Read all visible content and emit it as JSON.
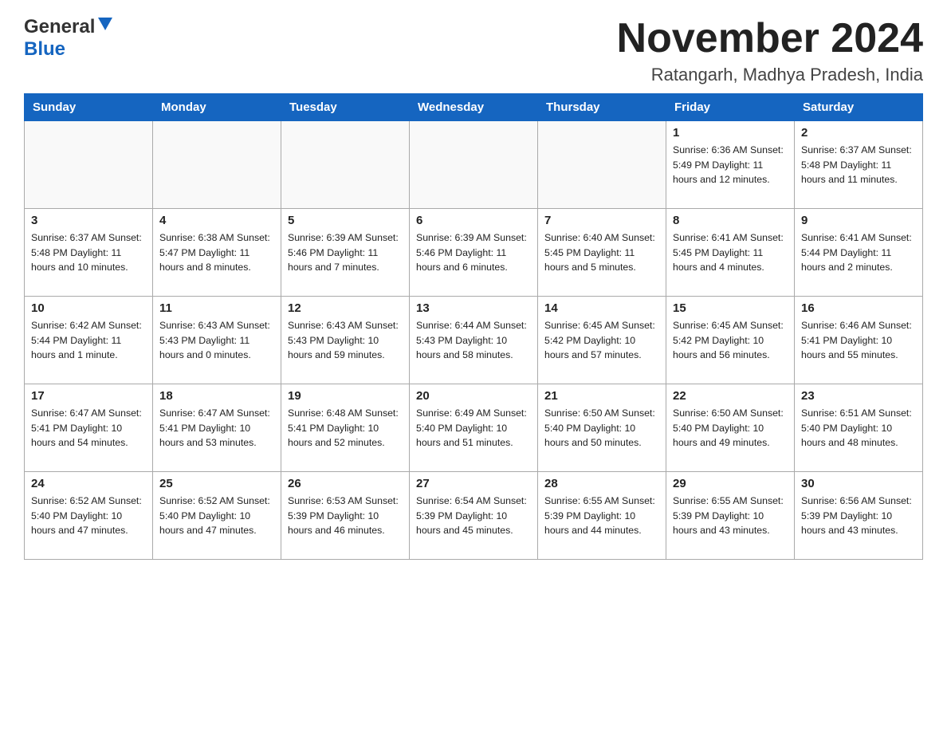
{
  "header": {
    "logo_general": "General",
    "logo_blue": "Blue",
    "main_title": "November 2024",
    "subtitle": "Ratangarh, Madhya Pradesh, India"
  },
  "days_of_week": [
    "Sunday",
    "Monday",
    "Tuesday",
    "Wednesday",
    "Thursday",
    "Friday",
    "Saturday"
  ],
  "weeks": [
    [
      {
        "day": "",
        "info": ""
      },
      {
        "day": "",
        "info": ""
      },
      {
        "day": "",
        "info": ""
      },
      {
        "day": "",
        "info": ""
      },
      {
        "day": "",
        "info": ""
      },
      {
        "day": "1",
        "info": "Sunrise: 6:36 AM\nSunset: 5:49 PM\nDaylight: 11 hours and 12 minutes."
      },
      {
        "day": "2",
        "info": "Sunrise: 6:37 AM\nSunset: 5:48 PM\nDaylight: 11 hours and 11 minutes."
      }
    ],
    [
      {
        "day": "3",
        "info": "Sunrise: 6:37 AM\nSunset: 5:48 PM\nDaylight: 11 hours and 10 minutes."
      },
      {
        "day": "4",
        "info": "Sunrise: 6:38 AM\nSunset: 5:47 PM\nDaylight: 11 hours and 8 minutes."
      },
      {
        "day": "5",
        "info": "Sunrise: 6:39 AM\nSunset: 5:46 PM\nDaylight: 11 hours and 7 minutes."
      },
      {
        "day": "6",
        "info": "Sunrise: 6:39 AM\nSunset: 5:46 PM\nDaylight: 11 hours and 6 minutes."
      },
      {
        "day": "7",
        "info": "Sunrise: 6:40 AM\nSunset: 5:45 PM\nDaylight: 11 hours and 5 minutes."
      },
      {
        "day": "8",
        "info": "Sunrise: 6:41 AM\nSunset: 5:45 PM\nDaylight: 11 hours and 4 minutes."
      },
      {
        "day": "9",
        "info": "Sunrise: 6:41 AM\nSunset: 5:44 PM\nDaylight: 11 hours and 2 minutes."
      }
    ],
    [
      {
        "day": "10",
        "info": "Sunrise: 6:42 AM\nSunset: 5:44 PM\nDaylight: 11 hours and 1 minute."
      },
      {
        "day": "11",
        "info": "Sunrise: 6:43 AM\nSunset: 5:43 PM\nDaylight: 11 hours and 0 minutes."
      },
      {
        "day": "12",
        "info": "Sunrise: 6:43 AM\nSunset: 5:43 PM\nDaylight: 10 hours and 59 minutes."
      },
      {
        "day": "13",
        "info": "Sunrise: 6:44 AM\nSunset: 5:43 PM\nDaylight: 10 hours and 58 minutes."
      },
      {
        "day": "14",
        "info": "Sunrise: 6:45 AM\nSunset: 5:42 PM\nDaylight: 10 hours and 57 minutes."
      },
      {
        "day": "15",
        "info": "Sunrise: 6:45 AM\nSunset: 5:42 PM\nDaylight: 10 hours and 56 minutes."
      },
      {
        "day": "16",
        "info": "Sunrise: 6:46 AM\nSunset: 5:41 PM\nDaylight: 10 hours and 55 minutes."
      }
    ],
    [
      {
        "day": "17",
        "info": "Sunrise: 6:47 AM\nSunset: 5:41 PM\nDaylight: 10 hours and 54 minutes."
      },
      {
        "day": "18",
        "info": "Sunrise: 6:47 AM\nSunset: 5:41 PM\nDaylight: 10 hours and 53 minutes."
      },
      {
        "day": "19",
        "info": "Sunrise: 6:48 AM\nSunset: 5:41 PM\nDaylight: 10 hours and 52 minutes."
      },
      {
        "day": "20",
        "info": "Sunrise: 6:49 AM\nSunset: 5:40 PM\nDaylight: 10 hours and 51 minutes."
      },
      {
        "day": "21",
        "info": "Sunrise: 6:50 AM\nSunset: 5:40 PM\nDaylight: 10 hours and 50 minutes."
      },
      {
        "day": "22",
        "info": "Sunrise: 6:50 AM\nSunset: 5:40 PM\nDaylight: 10 hours and 49 minutes."
      },
      {
        "day": "23",
        "info": "Sunrise: 6:51 AM\nSunset: 5:40 PM\nDaylight: 10 hours and 48 minutes."
      }
    ],
    [
      {
        "day": "24",
        "info": "Sunrise: 6:52 AM\nSunset: 5:40 PM\nDaylight: 10 hours and 47 minutes."
      },
      {
        "day": "25",
        "info": "Sunrise: 6:52 AM\nSunset: 5:40 PM\nDaylight: 10 hours and 47 minutes."
      },
      {
        "day": "26",
        "info": "Sunrise: 6:53 AM\nSunset: 5:39 PM\nDaylight: 10 hours and 46 minutes."
      },
      {
        "day": "27",
        "info": "Sunrise: 6:54 AM\nSunset: 5:39 PM\nDaylight: 10 hours and 45 minutes."
      },
      {
        "day": "28",
        "info": "Sunrise: 6:55 AM\nSunset: 5:39 PM\nDaylight: 10 hours and 44 minutes."
      },
      {
        "day": "29",
        "info": "Sunrise: 6:55 AM\nSunset: 5:39 PM\nDaylight: 10 hours and 43 minutes."
      },
      {
        "day": "30",
        "info": "Sunrise: 6:56 AM\nSunset: 5:39 PM\nDaylight: 10 hours and 43 minutes."
      }
    ]
  ]
}
